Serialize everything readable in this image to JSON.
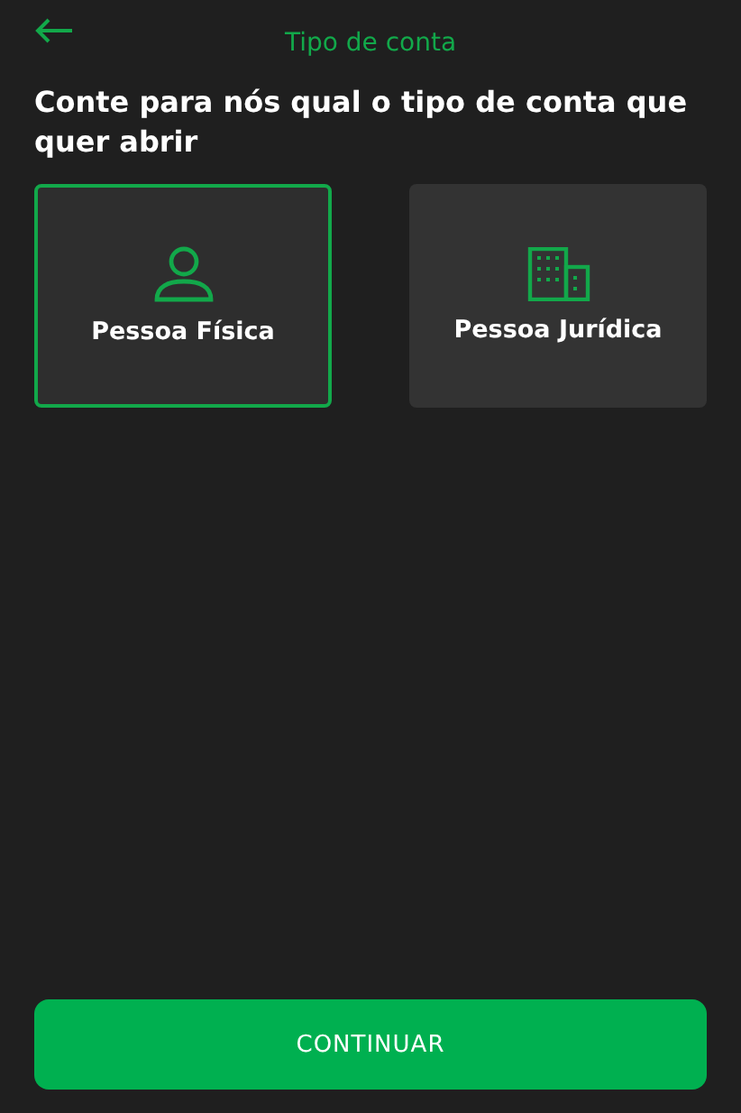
{
  "header": {
    "title": "Tipo de conta"
  },
  "heading": "Conte para nós qual o tipo de conta que quer abrir",
  "options": [
    {
      "label": "Pessoa Física",
      "kind": "person",
      "selected": true
    },
    {
      "label": "Pessoa Jurídica",
      "kind": "company",
      "selected": false
    }
  ],
  "button": {
    "label": "CONTINUAR"
  }
}
